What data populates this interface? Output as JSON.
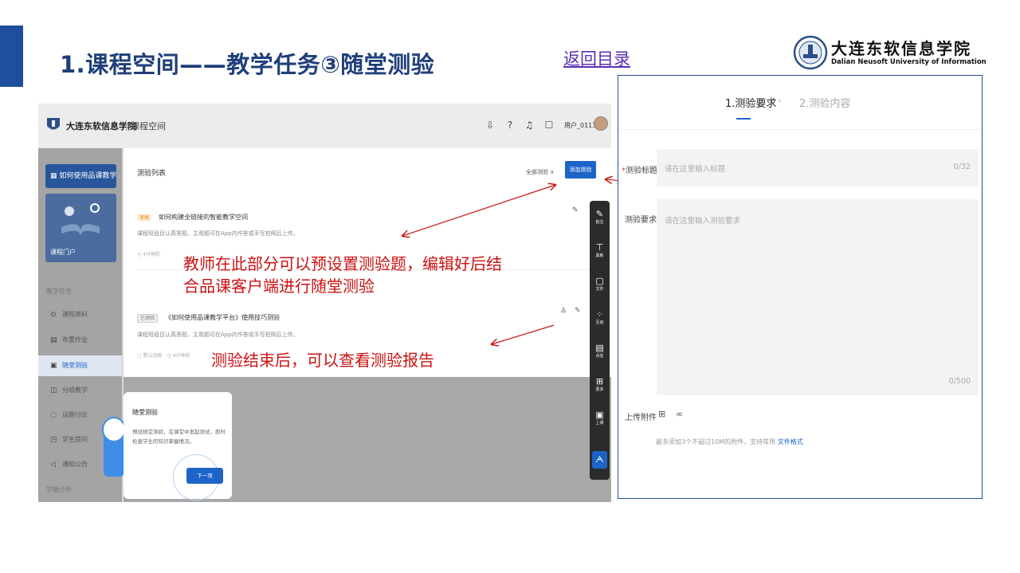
{
  "slide": {
    "title": "1.课程空间——教学任务③随堂测验",
    "back_link": "返回目录",
    "logo_cn": "大连东软信息学院",
    "logo_en": "Dalian Neusoft University of Information"
  },
  "app": {
    "school": "大连东软信息学院",
    "section": "课程空间",
    "user": "用户_0113",
    "sidebar": {
      "howto": "如何使用品课教学...",
      "portal": "课程门户",
      "section_teaching": "教学任务",
      "items": [
        {
          "label": "课程资料"
        },
        {
          "label": "布置作业"
        },
        {
          "label": "随堂测验"
        },
        {
          "label": "分组教学"
        },
        {
          "label": "话题讨论"
        },
        {
          "label": "学生提问"
        },
        {
          "label": "通知公告"
        }
      ],
      "section_analysis": "学情分析"
    },
    "quiz_list": {
      "title": "测验列表",
      "filter": "全部测验",
      "add_button": "添加测验",
      "cards": [
        {
          "tag": "草稿",
          "title": "如何构建全链接的智能教学空间",
          "desc": "课程班组目认真答题，主观题可在App内作答或手写拍照后上传。",
          "meta": "4分钟前"
        },
        {
          "tag": "已测验",
          "title": "《如何使用品课教学平台》使用技巧测验",
          "desc": "课程班组目认真答题，主观题可在App内作答或手写拍照后上传。",
          "meta_left": "默认班级",
          "meta": "4分钟前"
        }
      ]
    },
    "toolbar": [
      "批注",
      "黑板",
      "文件",
      "互动",
      "点名",
      "更多",
      "上课"
    ],
    "tooltip": {
      "title": "随堂测验",
      "desc": "预设随堂测验，在课堂中发起测试，即时检查学生的知识掌握情况。",
      "next": "下一项"
    }
  },
  "annotations": {
    "note1_line1": "教师在此部分可以预设置测验题，编辑好后结",
    "note1_line2": "合品课客户端进行随堂测验",
    "note2": "测验结束后，可以查看测验报告"
  },
  "quiz_form": {
    "step1": "1.测验要求",
    "step2": "2.测验内容",
    "title_label": "测验标题",
    "title_placeholder": "请在这里输入标题",
    "title_count": "0/32",
    "req_label": "测验要求",
    "req_placeholder": "请在这里输入测验要求",
    "req_count": "0/500",
    "upload_label": "上传附件",
    "upload_note": "最多添加3个不超过10M的附件，支持常用",
    "upload_note_link": "文件格式"
  },
  "colors": {
    "accent": "#1f4e9c",
    "primary_button": "#1d63c8",
    "annotation": "#cc1111"
  }
}
